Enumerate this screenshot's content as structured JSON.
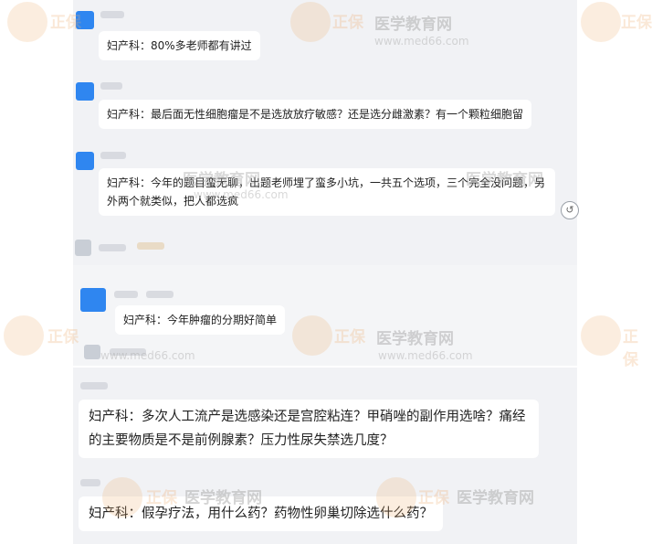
{
  "chat": {
    "messages": [
      {
        "text": "妇产科：80%多老师都有讲过"
      },
      {
        "text": "妇产科：最后面无性细胞瘤是不是选放放疗敏感？还是选分雌激素？有一个颗粒细胞留"
      },
      {
        "text": "妇产科：今年的题目蛮无聊，出题老师埋了蛮多小坑，一共五个选项，三个完全没问题，另外两个就类似，把人都选疯"
      },
      {
        "text": "妇产科：今年肿瘤的分期好简单"
      },
      {
        "text": "妇产科：多次人工流产是选感染还是宫腔粘连？甲硝唑的副作用选啥？痛经的主要物质是不是前例腺素？压力性尿失禁选几度？"
      },
      {
        "text": "妇产科：假孕疗法，用什么药？药物性卵巢切除选什么药？"
      }
    ]
  },
  "watermark": {
    "brand": "正保",
    "site": "医学教育网",
    "url": "www.med66.com"
  },
  "icons": {
    "side_action": "reply-icon"
  },
  "colors": {
    "panel": "#f1f2f5",
    "avatar_blue": "#2f86f0",
    "bubble": "#ffffff"
  }
}
